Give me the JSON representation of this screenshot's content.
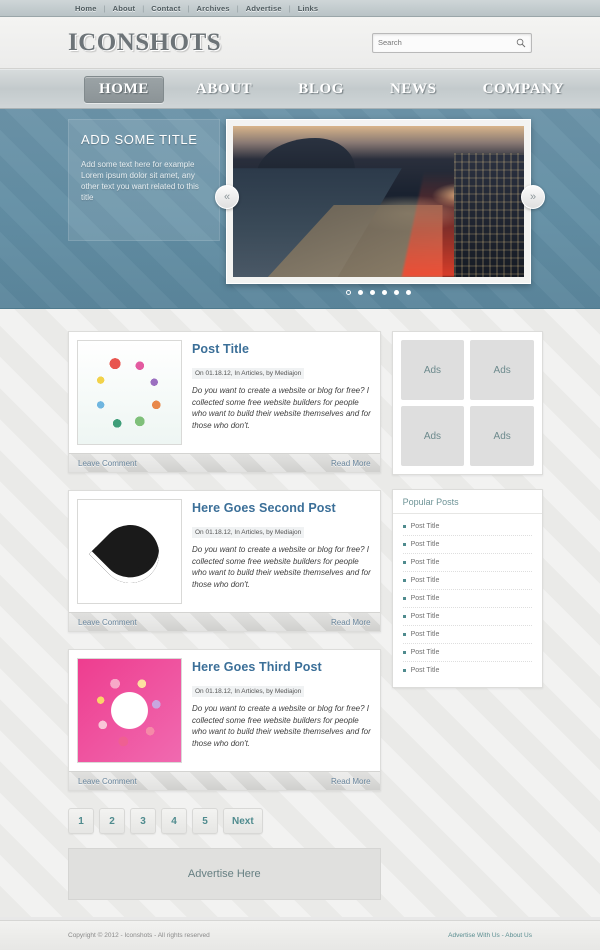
{
  "topbar": {
    "links": [
      "Home",
      "About",
      "Contact",
      "Archives",
      "Advertise",
      "Links"
    ],
    "separator": "|"
  },
  "header": {
    "logo": "ICONSHOTS",
    "search": {
      "placeholder": "Search",
      "value": "",
      "icon": "search-icon"
    }
  },
  "mainnav": {
    "items": [
      {
        "label": "HOME",
        "active": true
      },
      {
        "label": "ABOUT",
        "active": false
      },
      {
        "label": "BLOG",
        "active": false
      },
      {
        "label": "NEWS",
        "active": false
      },
      {
        "label": "COMPANY",
        "active": false
      }
    ]
  },
  "hero": {
    "caption_title": "ADD SOME TITLE",
    "caption_text": "Add some text here for example Lorem ipsum dolor sit amet, any other text you want related to this title",
    "prev_label": "«",
    "next_label": "»",
    "dots": 6,
    "active_dot": 0
  },
  "posts": [
    {
      "title": "Post Title",
      "meta": "On 01.18.12, In Articles, by Mediajon",
      "excerpt": "Do you want to create a website or blog for free? I collected some free website builders for people who want to build their website themselves and for those who don't.",
      "comment_label": "Leave Comment",
      "read_label": "Read More",
      "thumb": "abstract-background-circles"
    },
    {
      "title": "Here Goes Second Post",
      "meta": "On 01.18.12, In Articles, by Mediajon",
      "excerpt": "Do you want to create a website or blog for free? I collected some free website builders for people who want to build their website themselves and for those who don't.",
      "comment_label": "Leave Comment",
      "read_label": "Read More",
      "thumb": "ornamental-heart"
    },
    {
      "title": "Here Goes Third Post",
      "meta": "On 01.18.12, In Articles, by Mediajon",
      "excerpt": "Do you want to create a website or blog for free? I collected some free website builders for people who want to build their website themselves and for those who don't.",
      "comment_label": "Leave Comment",
      "read_label": "Read More",
      "thumb": "pink-circle-collage"
    }
  ],
  "pagination": {
    "pages": [
      "1",
      "2",
      "3",
      "4",
      "5"
    ],
    "next_label": "Next"
  },
  "advertise_banner": "Advertise Here",
  "sidebar": {
    "ads": [
      "Ads",
      "Ads",
      "Ads",
      "Ads"
    ],
    "popular": {
      "title": "Popular Posts",
      "items": [
        "Post Title",
        "Post Title",
        "Post Title",
        "Post Title",
        "Post Title",
        "Post Title",
        "Post Title",
        "Post Title",
        "Post Title"
      ]
    }
  },
  "footer": {
    "copyright": "Copyright © 2012 - Iconshots - All rights reserved",
    "links": [
      "Advertise With Us",
      "About Us"
    ],
    "link_separator": "-"
  },
  "colors": {
    "accent_blue": "#3b6f98",
    "accent_teal": "#4f8b8e",
    "hero_bg": "#628ea4",
    "link_gray_blue": "#69859c"
  }
}
